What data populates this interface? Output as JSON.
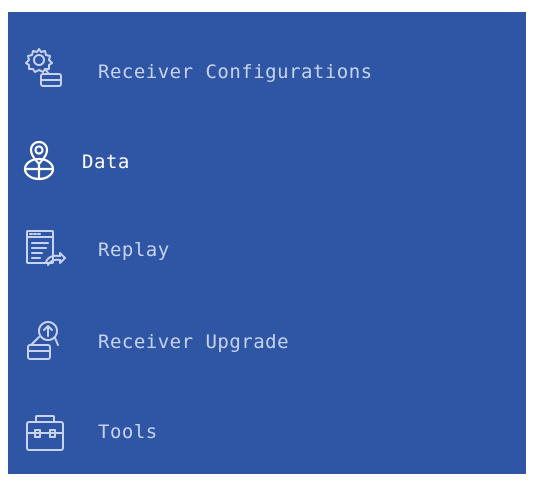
{
  "menu": {
    "items": [
      {
        "label": "Receiver Configurations",
        "icon": "settings-receiver-icon",
        "active": false
      },
      {
        "label": "Data",
        "icon": "location-data-icon",
        "active": true
      },
      {
        "label": "Replay",
        "icon": "replay-icon",
        "active": false
      },
      {
        "label": "Receiver Upgrade",
        "icon": "upgrade-icon",
        "active": false
      },
      {
        "label": "Tools",
        "icon": "toolbox-icon",
        "active": false
      }
    ]
  },
  "colors": {
    "panel_background": "#2f55a5",
    "inactive_text": "#c8d3ef",
    "active_text": "#ffffff"
  }
}
